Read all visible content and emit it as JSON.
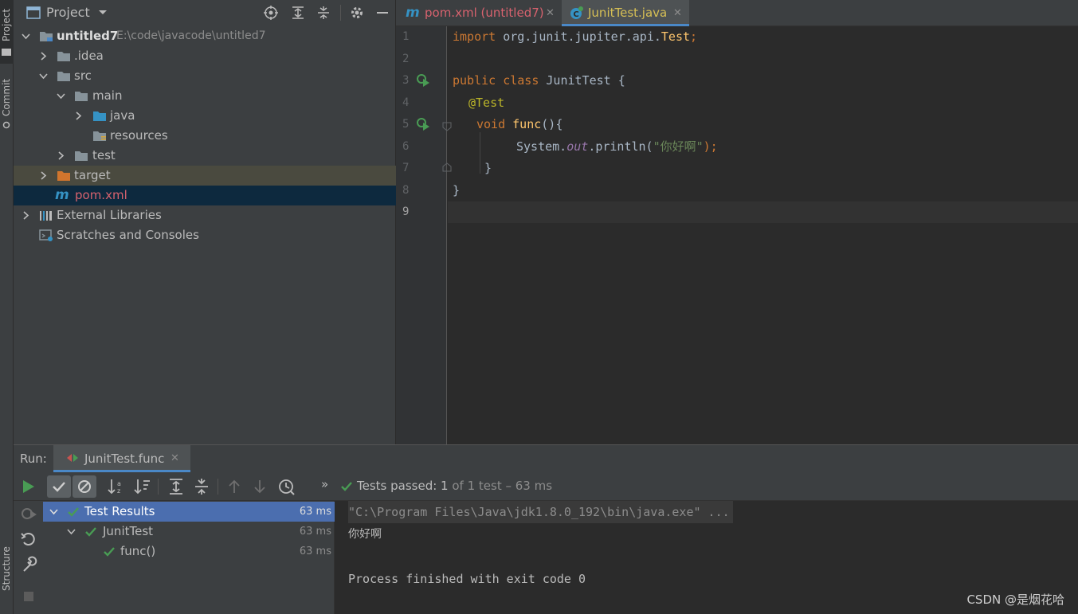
{
  "left_strip": {
    "project_tab": "Project",
    "commit_tab": "Commit",
    "structure_tab": "Structure"
  },
  "project": {
    "title": "Project",
    "tree": [
      {
        "label": "untitled7",
        "path": "E:\\code\\javacode\\untitled7"
      },
      {
        "label": ".idea"
      },
      {
        "label": "src"
      },
      {
        "label": "main"
      },
      {
        "label": "java"
      },
      {
        "label": "resources"
      },
      {
        "label": "test"
      },
      {
        "label": "target"
      },
      {
        "label": "pom.xml"
      },
      {
        "label": "External Libraries"
      },
      {
        "label": "Scratches and Consoles"
      }
    ]
  },
  "editor": {
    "tabs": [
      {
        "label": "pom.xml (untitled7)"
      },
      {
        "label": "JunitTest.java"
      }
    ],
    "line_numbers": [
      "1",
      "2",
      "3",
      "4",
      "5",
      "6",
      "7",
      "8",
      "9"
    ],
    "code": {
      "l1_kw": "import",
      "l1_rest": " org.junit.jupiter.api.",
      "l1_cls": "Test",
      "l1_semi": ";",
      "l3_kw": "public class",
      "l3_rest": " JunitTest {",
      "l4_ann": "@Test",
      "l5_kw": "void",
      "l5_fn": " func",
      "l5_rest": "(){",
      "l6_a": "System.",
      "l6_field": "out",
      "l6_b": ".println(",
      "l6_str": "\"你好啊\"",
      "l6_c": ");",
      "l7": "}",
      "l8": "}"
    }
  },
  "run": {
    "label": "Run:",
    "tab": "JunitTest.func",
    "status_prefix": "Tests passed: ",
    "status_count": "1",
    "status_suffix": " of 1 test – 63 ms",
    "tree": [
      {
        "label": "Test Results",
        "time": "63 ms"
      },
      {
        "label": "JunitTest",
        "time": "63 ms"
      },
      {
        "label": "func()",
        "time": "63 ms"
      }
    ],
    "console": [
      "\"C:\\Program Files\\Java\\jdk1.8.0_192\\bin\\java.exe\" ...",
      "你好啊",
      "",
      "Process finished with exit code 0"
    ]
  },
  "watermark": "CSDN @是烟花哈",
  "colors": {
    "panel_bg": "#3c3f41",
    "editor_bg": "#2b2b2b",
    "selection": "#0d293e",
    "test_selection": "#4b6eaf",
    "keyword": "#cc7832",
    "annotation": "#bbb529",
    "string": "#6a8759",
    "pass_green": "#499c54"
  }
}
